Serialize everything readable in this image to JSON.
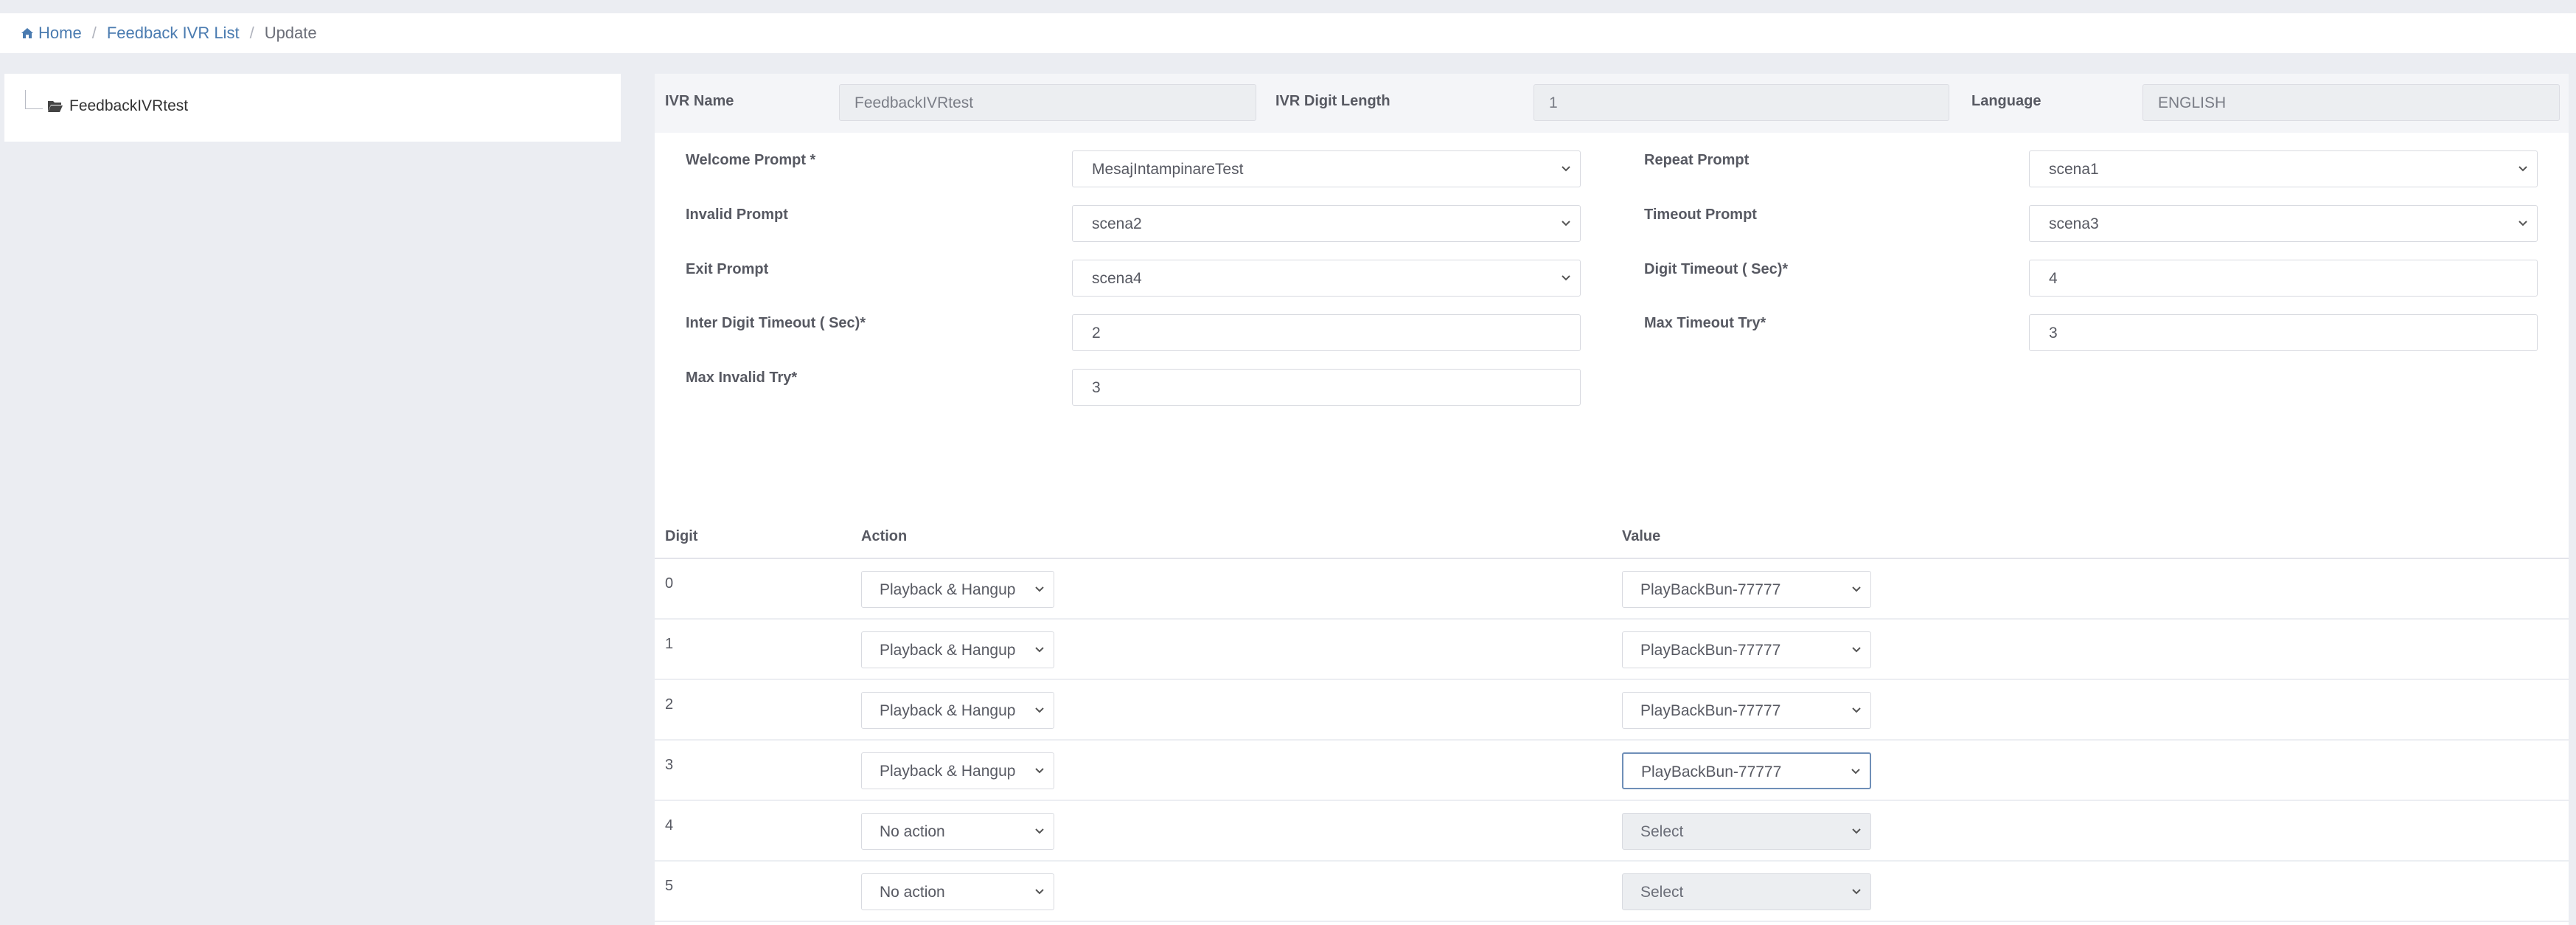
{
  "breadcrumb": {
    "home": "Home",
    "list": "Feedback IVR List",
    "current": "Update",
    "separator": "/"
  },
  "tree": {
    "node_label": "FeedbackIVRtest"
  },
  "header": {
    "ivr_name_label": "IVR Name",
    "ivr_name_value": "FeedbackIVRtest",
    "ivr_digit_length_label": "IVR Digit Length",
    "ivr_digit_length_value": "1",
    "language_label": "Language",
    "language_value": "ENGLISH"
  },
  "form": {
    "welcome_prompt_label": "Welcome Prompt *",
    "welcome_prompt_value": "MesajIntampinareTest",
    "repeat_prompt_label": "Repeat Prompt",
    "repeat_prompt_value": "scena1",
    "invalid_prompt_label": "Invalid Prompt",
    "invalid_prompt_value": "scena2",
    "timeout_prompt_label": "Timeout Prompt",
    "timeout_prompt_value": "scena3",
    "exit_prompt_label": "Exit Prompt",
    "exit_prompt_value": "scena4",
    "digit_timeout_label": "Digit Timeout ( Sec)*",
    "digit_timeout_value": "4",
    "inter_digit_timeout_label": "Inter Digit Timeout ( Sec)*",
    "inter_digit_timeout_value": "2",
    "max_timeout_try_label": "Max Timeout Try*",
    "max_timeout_try_value": "3",
    "max_invalid_try_label": "Max Invalid Try*",
    "max_invalid_try_value": "3"
  },
  "table": {
    "headers": {
      "digit": "Digit",
      "action": "Action",
      "value": "Value"
    },
    "rows": [
      {
        "digit": "0",
        "action": "Playback & Hangup",
        "value": "PlayBackBun-77777"
      },
      {
        "digit": "1",
        "action": "Playback & Hangup",
        "value": "PlayBackBun-77777"
      },
      {
        "digit": "2",
        "action": "Playback & Hangup",
        "value": "PlayBackBun-77777"
      },
      {
        "digit": "3",
        "action": "Playback & Hangup",
        "value": "PlayBackBun-77777"
      },
      {
        "digit": "4",
        "action": "No action",
        "value": "Select"
      },
      {
        "digit": "5",
        "action": "No action",
        "value": "Select"
      }
    ]
  },
  "colors": {
    "link": "#4a7bb0",
    "page_bg": "#ebedf2",
    "focus_border": "#6f8fb8"
  }
}
